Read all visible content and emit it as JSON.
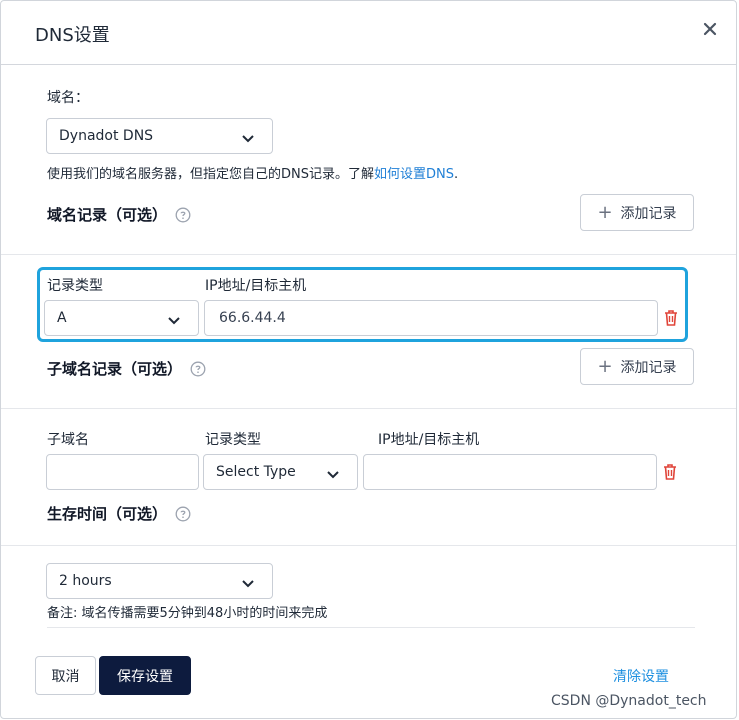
{
  "dialog": {
    "title": "DNS设置"
  },
  "domain": {
    "label": "域名：",
    "selected": "Dynadot DNS",
    "hint_prefix": "使用我们的域名服务器，但指定您自己的DNS记录。了解",
    "hint_link": "如何设置DNS",
    "hint_suffix": "."
  },
  "domain_records": {
    "title": "域名记录（可选）",
    "add_label": "添加记录",
    "col_type": "记录类型",
    "col_ip": "IP地址/目标主机",
    "row": {
      "type": "A",
      "ip": "66.6.44.4"
    }
  },
  "subdomain_records": {
    "title": "子域名记录（可选）",
    "add_label": "添加记录",
    "col_sub": "子域名",
    "col_type": "记录类型",
    "col_ip": "IP地址/目标主机",
    "row": {
      "sub": "",
      "type": "Select Type",
      "ip": ""
    }
  },
  "ttl": {
    "title": "生存时间（可选）",
    "selected": "2 hours",
    "note": "备注: 域名传播需要5分钟到48小时的时间来完成"
  },
  "footer": {
    "cancel": "取消",
    "save": "保存设置",
    "clear": "清除设置"
  },
  "watermark": "CSDN @Dynadot_tech",
  "colors": {
    "accent": "#1fa3dd",
    "primary_button": "#0d1b3e",
    "link": "#1f7fd6",
    "delete": "#e0453a"
  }
}
